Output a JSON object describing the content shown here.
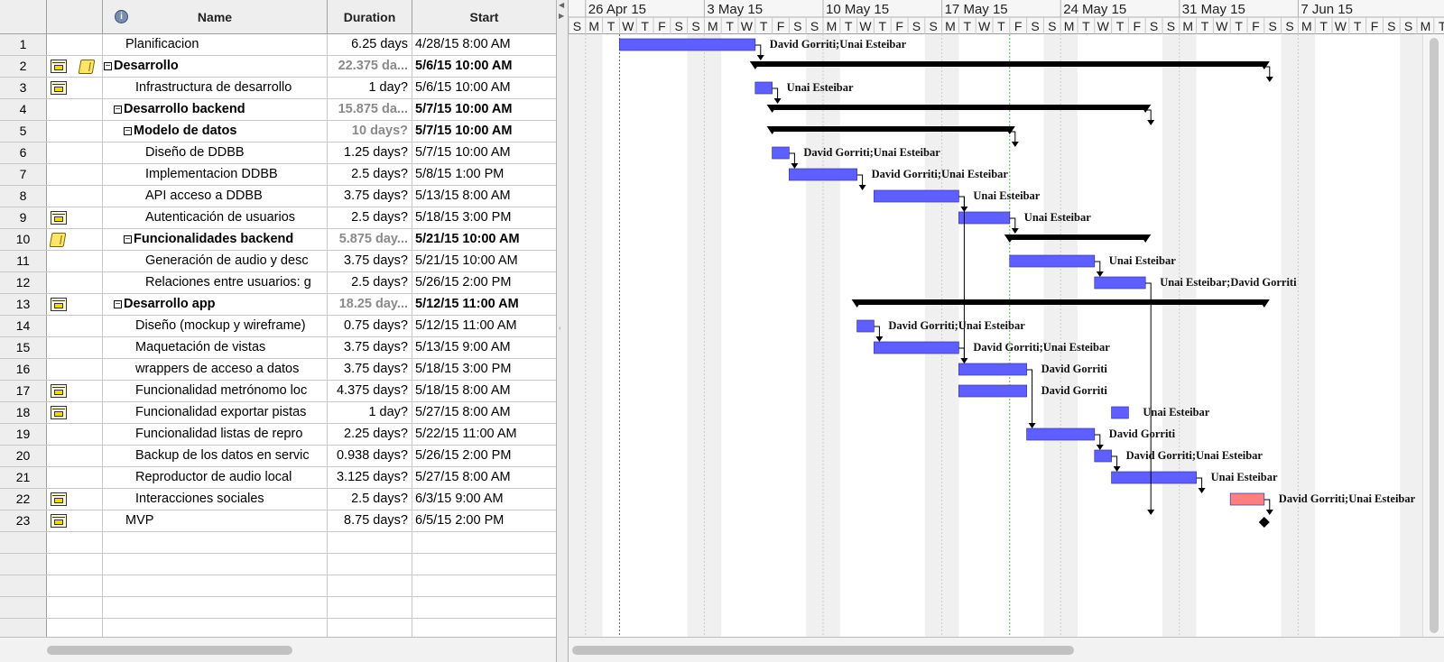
{
  "columns": {
    "info_icon": "i",
    "name": "Name",
    "duration": "Duration",
    "start": "Start"
  },
  "timeline": {
    "start_date": "2015-04-25",
    "week_labels": [
      "26 Apr 15",
      "3 May 15",
      "10 May 15",
      "17 May 15",
      "24 May 15",
      "31 May 15",
      "7 Jun 15"
    ],
    "day_letters": [
      "S",
      "M",
      "T",
      "W",
      "T",
      "F",
      "S"
    ],
    "today": "2015-05-21"
  },
  "colors": {
    "bar": "#5f5fff",
    "bar_critical": "#ff8080",
    "summary": "#000000",
    "today_line": "#33cc33"
  },
  "tasks": [
    {
      "num": "1",
      "name": "Planificacion",
      "indent": 1,
      "duration": "6.25 days",
      "start": "4/28/15 8:00 AM",
      "resources": "David Gorriti;Unai Esteibar",
      "bar": [
        "2015-04-28",
        "2015-05-06"
      ],
      "type": "task"
    },
    {
      "num": "2",
      "name": "Desarrollo",
      "indent": 0,
      "toggle": "⊟",
      "bold": true,
      "grey_duration": true,
      "icons": [
        "calendar-icon",
        "note-icon"
      ],
      "duration": "22.375 da...",
      "start": "5/6/15 10:00 AM",
      "bar": [
        "2015-05-06",
        "2015-06-05"
      ],
      "type": "summary"
    },
    {
      "num": "3",
      "name": "Infrastructura de desarrollo",
      "indent": 2,
      "icons": [
        "calendar-icon"
      ],
      "duration": "1 day?",
      "start": "5/6/15 10:00 AM",
      "resources": "Unai Esteibar",
      "bar": [
        "2015-05-06",
        "2015-05-07"
      ],
      "type": "task"
    },
    {
      "num": "4",
      "name": "Desarrollo backend",
      "indent": 1,
      "toggle": "⊟",
      "bold": true,
      "grey_duration": true,
      "duration": "15.875 da...",
      "start": "5/7/15 10:00 AM",
      "bar": [
        "2015-05-07",
        "2015-05-29"
      ],
      "type": "summary"
    },
    {
      "num": "5",
      "name": "Modelo de datos",
      "indent": 2,
      "toggle": "⊟",
      "bold": true,
      "grey_duration": true,
      "duration": "10 days?",
      "start": "5/7/15 10:00 AM",
      "bar": [
        "2015-05-07",
        "2015-05-21"
      ],
      "type": "summary"
    },
    {
      "num": "6",
      "name": "Diseño de DDBB",
      "indent": 3,
      "duration": "1.25 days?",
      "start": "5/7/15 10:00 AM",
      "resources": "David Gorriti;Unai Esteibar",
      "bar": [
        "2015-05-07",
        "2015-05-08"
      ],
      "type": "task"
    },
    {
      "num": "7",
      "name": "Implementacion DDBB",
      "indent": 3,
      "duration": "2.5 days?",
      "start": "5/8/15 1:00 PM",
      "resources": "David Gorriti;Unai Esteibar",
      "bar": [
        "2015-05-08",
        "2015-05-12"
      ],
      "type": "task"
    },
    {
      "num": "8",
      "name": "API acceso a DDBB",
      "indent": 3,
      "duration": "3.75 days?",
      "start": "5/13/15 8:00 AM",
      "resources": "Unai Esteibar",
      "bar": [
        "2015-05-13",
        "2015-05-18"
      ],
      "type": "task"
    },
    {
      "num": "9",
      "name": "Autenticación de usuarios",
      "indent": 3,
      "icons": [
        "calendar-icon"
      ],
      "duration": "2.5 days?",
      "start": "5/18/15 3:00 PM",
      "resources": "Unai Esteibar",
      "bar": [
        "2015-05-18",
        "2015-05-21"
      ],
      "type": "task"
    },
    {
      "num": "10",
      "name": "Funcionalidades backend",
      "indent": 2,
      "toggle": "⊟",
      "bold": true,
      "grey_duration": true,
      "icons": [
        "note-icon"
      ],
      "duration": "5.875 day...",
      "start": "5/21/15 10:00 AM",
      "bar": [
        "2015-05-21",
        "2015-05-29"
      ],
      "type": "summary"
    },
    {
      "num": "11",
      "name": "Generación de audio y desc",
      "indent": 3,
      "duration": "3.75 days?",
      "start": "5/21/15 10:00 AM",
      "resources": "Unai Esteibar",
      "bar": [
        "2015-05-21",
        "2015-05-26"
      ],
      "type": "task"
    },
    {
      "num": "12",
      "name": "Relaciones entre usuarios: g",
      "indent": 3,
      "duration": "2.5 days?",
      "start": "5/26/15 2:00 PM",
      "resources": "Unai Esteibar;David Gorriti",
      "bar": [
        "2015-05-26",
        "2015-05-29"
      ],
      "type": "task"
    },
    {
      "num": "13",
      "name": "Desarrollo app",
      "indent": 1,
      "toggle": "⊟",
      "bold": true,
      "grey_duration": true,
      "icons": [
        "calendar-icon"
      ],
      "duration": "18.25 day...",
      "start": "5/12/15 11:00 AM",
      "bar": [
        "2015-05-12",
        "2015-06-05"
      ],
      "type": "summary"
    },
    {
      "num": "14",
      "name": "Diseño (mockup y wireframe)",
      "indent": 2,
      "duration": "0.75 days?",
      "start": "5/12/15 11:00 AM",
      "resources": "David Gorriti;Unai Esteibar",
      "bar": [
        "2015-05-12",
        "2015-05-13"
      ],
      "type": "task"
    },
    {
      "num": "15",
      "name": "Maquetación de vistas",
      "indent": 2,
      "duration": "3.75 days?",
      "start": "5/13/15 9:00 AM",
      "resources": "David Gorriti;Unai Esteibar",
      "bar": [
        "2015-05-13",
        "2015-05-18"
      ],
      "type": "task"
    },
    {
      "num": "16",
      "name": "wrappers de acceso a datos",
      "indent": 2,
      "duration": "3.75 days?",
      "start": "5/18/15 3:00 PM",
      "resources": "David Gorriti",
      "bar": [
        "2015-05-18",
        "2015-05-22"
      ],
      "type": "task"
    },
    {
      "num": "17",
      "name": "Funcionalidad metrónomo loc",
      "indent": 2,
      "icons": [
        "calendar-icon"
      ],
      "duration": "4.375 days?",
      "start": "5/18/15 8:00 AM",
      "resources": "David Gorriti",
      "bar": [
        "2015-05-18",
        "2015-05-22"
      ],
      "type": "task"
    },
    {
      "num": "18",
      "name": "Funcionalidad exportar pistas",
      "indent": 2,
      "icons": [
        "calendar-icon"
      ],
      "duration": "1 day?",
      "start": "5/27/15 8:00 AM",
      "resources": "Unai Esteibar",
      "bar": [
        "2015-05-27",
        "2015-05-28"
      ],
      "type": "task"
    },
    {
      "num": "19",
      "name": "Funcionalidad listas de repro",
      "indent": 2,
      "duration": "2.25 days?",
      "start": "5/22/15 11:00 AM",
      "resources": "David Gorriti",
      "bar": [
        "2015-05-22",
        "2015-05-26"
      ],
      "type": "task"
    },
    {
      "num": "20",
      "name": "Backup de los datos en servic",
      "indent": 2,
      "duration": "0.938 days?",
      "start": "5/26/15 2:00 PM",
      "resources": "David Gorriti;Unai Esteibar",
      "bar": [
        "2015-05-26",
        "2015-05-27"
      ],
      "type": "task"
    },
    {
      "num": "21",
      "name": "Reproductor de audio local",
      "indent": 2,
      "duration": "3.125 days?",
      "start": "5/27/15 8:00 AM",
      "resources": "Unai Esteibar",
      "bar": [
        "2015-05-27",
        "2015-06-01"
      ],
      "type": "task"
    },
    {
      "num": "22",
      "name": "Interacciones sociales",
      "indent": 2,
      "icons": [
        "calendar-icon"
      ],
      "duration": "2.5 days?",
      "start": "6/3/15 9:00 AM",
      "resources": "David Gorriti;Unai Esteibar",
      "bar": [
        "2015-06-03",
        "2015-06-05"
      ],
      "type": "critical"
    },
    {
      "num": "23",
      "name": "MVP",
      "indent": 1,
      "icons": [
        "calendar-icon"
      ],
      "duration": "8.75 days?",
      "start": "6/5/15 2:00 PM",
      "bar": [
        "2015-06-05",
        "2015-06-05"
      ],
      "type": "milestone"
    }
  ],
  "dependencies": [
    [
      "1",
      "2"
    ],
    [
      "2",
      "3"
    ],
    [
      "3",
      "4"
    ],
    [
      "4",
      "5"
    ],
    [
      "5",
      "6"
    ],
    [
      "6",
      "7"
    ],
    [
      "7",
      "8"
    ],
    [
      "8",
      "9"
    ],
    [
      "9",
      "10"
    ],
    [
      "11",
      "12"
    ],
    [
      "14",
      "15"
    ],
    [
      "15",
      "16"
    ],
    [
      "16",
      "19"
    ],
    [
      "19",
      "20"
    ],
    [
      "20",
      "21"
    ],
    [
      "21",
      "22"
    ],
    [
      "22",
      "23"
    ],
    [
      "8",
      "16"
    ],
    [
      "12",
      "23"
    ]
  ]
}
